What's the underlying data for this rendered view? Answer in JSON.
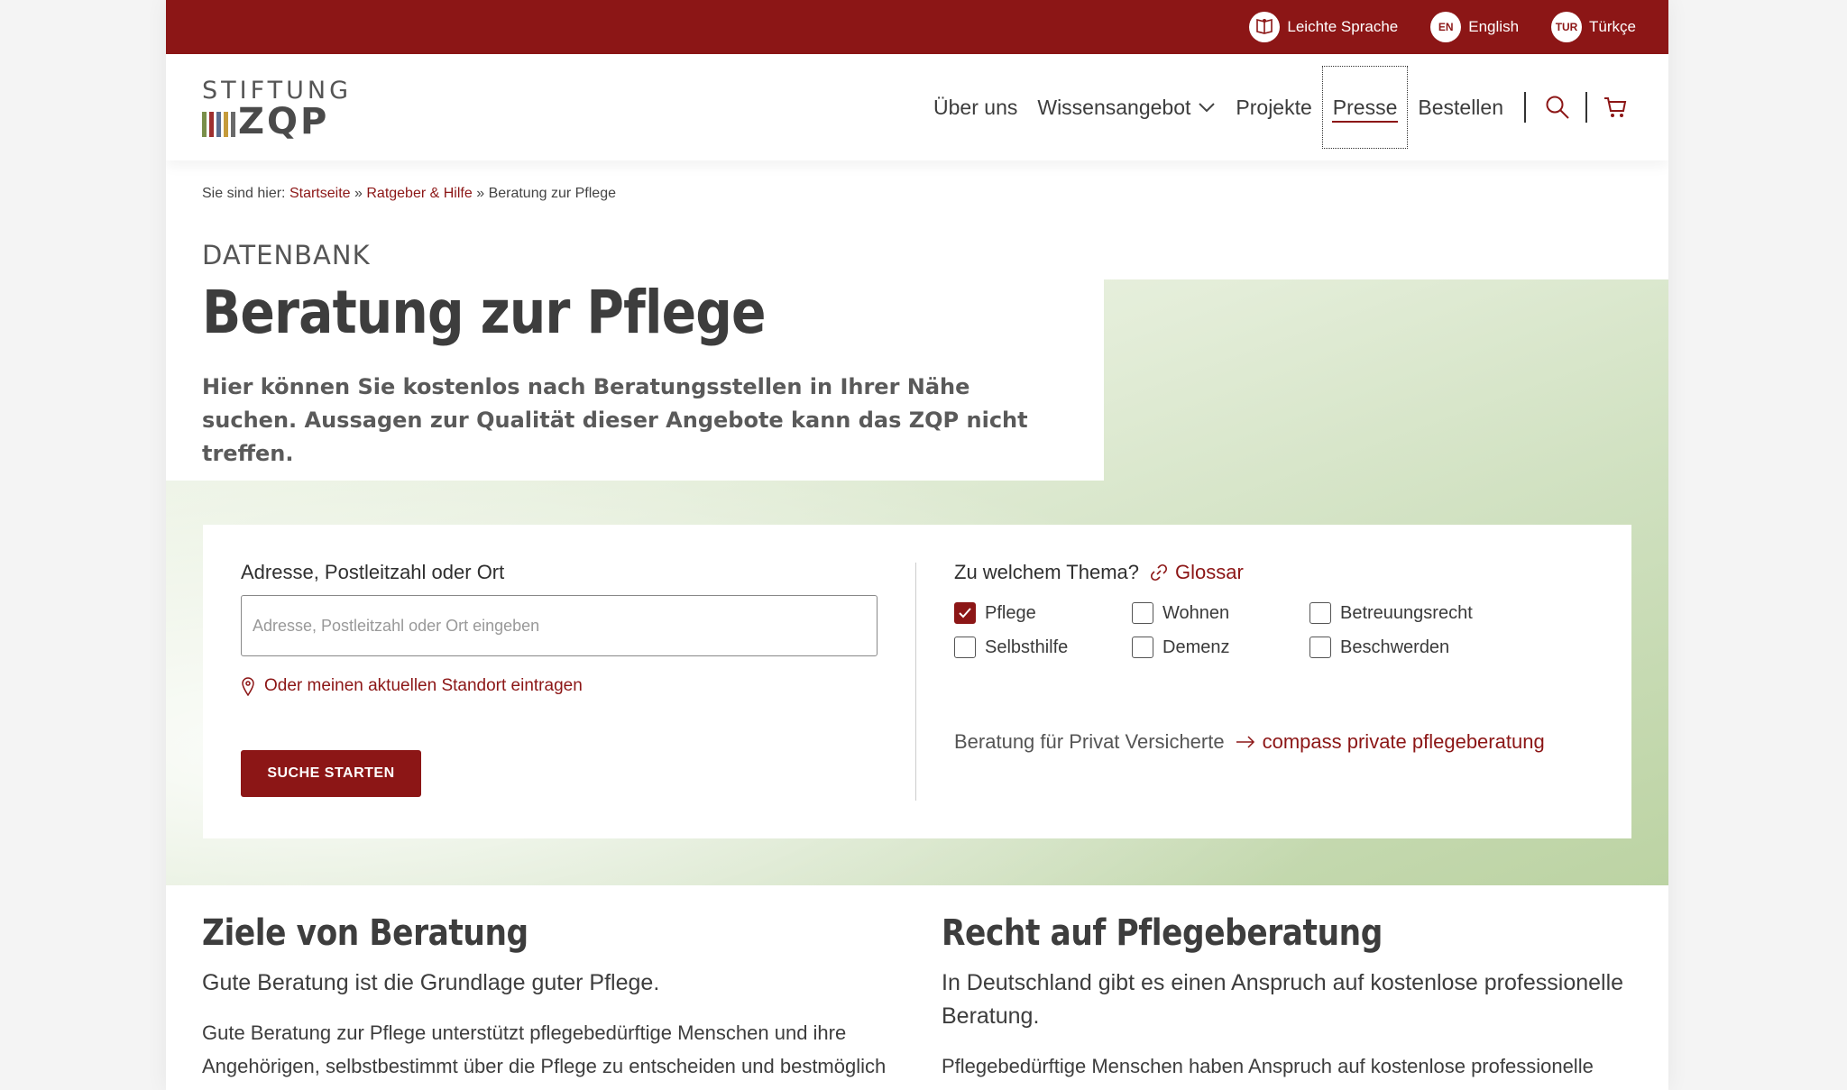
{
  "topbar": {
    "links": [
      {
        "badge": "",
        "label": "Leichte Sprache",
        "icon": "easy-language-icon"
      },
      {
        "badge": "EN",
        "label": "English",
        "icon": "language-badge"
      },
      {
        "badge": "TUR",
        "label": "Türkçe",
        "icon": "language-badge"
      }
    ]
  },
  "logo": {
    "line1": "STIFTUNG",
    "line2": "ZQP",
    "bar_colors": [
      "#7a8f4a",
      "#9e2f2f",
      "#5b6e8f",
      "#c59b3b",
      "#6a6a6a"
    ]
  },
  "nav": {
    "items": [
      "Über uns",
      "Wissensangebot",
      "Projekte",
      "Presse",
      "Bestellen"
    ],
    "active": "Presse"
  },
  "breadcrumb": {
    "prefix": "Sie sind hier:",
    "links": [
      "Startseite",
      "Ratgeber & Hilfe"
    ],
    "sep": "»",
    "current": "Beratung zur Pflege"
  },
  "hero": {
    "kicker": "DATENBANK",
    "title": "Beratung zur Pflege",
    "lead": "Hier können Sie kostenlos nach Beratungsstellen in Ihrer Nähe suchen. Aussagen zur Qualität dieser Angebote kann das ZQP nicht treffen."
  },
  "search": {
    "label": "Adresse, Postleitzahl oder Ort",
    "value": "",
    "placeholder": "Adresse, Postleitzahl oder Ort eingeben",
    "locate": "Oder meinen aktuellen Standort eintragen",
    "button": "SUCHE STARTEN"
  },
  "topics": {
    "question": "Zu welchem Thema?",
    "glossary": "Glossar",
    "options": [
      {
        "label": "Pflege",
        "checked": true
      },
      {
        "label": "Wohnen",
        "checked": false
      },
      {
        "label": "Betreuungsrecht",
        "checked": false
      },
      {
        "label": "Selbsthilfe",
        "checked": false
      },
      {
        "label": "Demenz",
        "checked": false
      },
      {
        "label": "Beschwerden",
        "checked": false
      }
    ],
    "private_text": "Beratung für Privat Versicherte",
    "private_link": "compass private pflegeberatung"
  },
  "sections": [
    {
      "title": "Ziele von Beratung",
      "sub": "Gute Beratung ist die Grundlage guter Pflege.",
      "body": "Gute Beratung zur Pflege unterstützt pflegebedürftige Menschen und ihre Angehörigen, selbstbestimmt über die Pflege zu entscheiden und bestmöglich"
    },
    {
      "title": "Recht auf Pflegeberatung",
      "sub": "In Deutschland gibt es einen Anspruch auf kostenlose professionelle Beratung.",
      "body": "Pflegebedürftige Menschen haben Anspruch auf kostenlose professionelle"
    }
  ],
  "colors": {
    "brand": "#8c1616",
    "hero_green": "#cfe0bf"
  }
}
